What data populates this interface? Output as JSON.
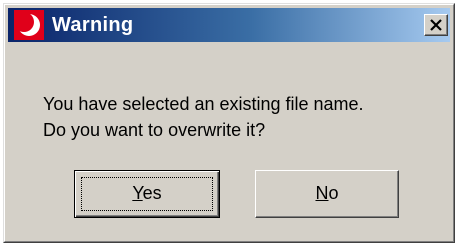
{
  "window": {
    "title": "Warning",
    "icon": "red-crescent-app-icon",
    "close_icon": "close-icon",
    "title_gradient": [
      "#0a246a",
      "#a6caf0"
    ]
  },
  "message": {
    "line1": "You have selected an existing file name.",
    "line2": "Do you want to overwrite it?"
  },
  "buttons": {
    "yes": {
      "mnemonic": "Y",
      "rest": "es"
    },
    "no": {
      "mnemonic": "N",
      "rest": "o"
    }
  },
  "colors": {
    "face": "#d4d0c8",
    "icon_red": "#e0001a"
  }
}
